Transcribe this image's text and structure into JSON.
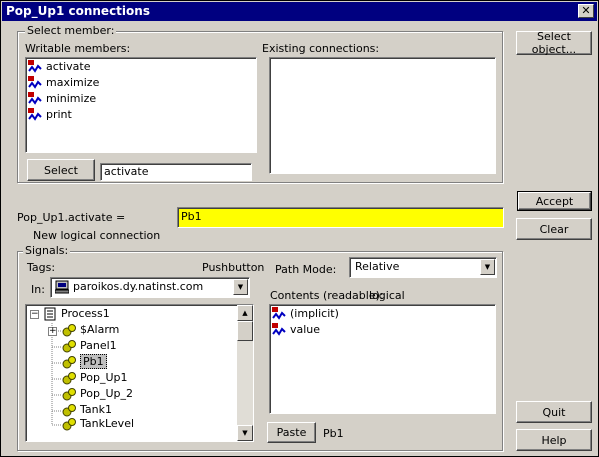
{
  "window": {
    "title": "Pop_Up1 connections",
    "close_label": "✕"
  },
  "select_member": {
    "legend": "Select member:",
    "writable_label": "Writable members:",
    "existing_label": "Existing connections:",
    "members": [
      "activate",
      "maximize",
      "minimize",
      "print"
    ],
    "select_button": "Select",
    "select_value": "activate"
  },
  "buttons": {
    "select_object": "Select object...",
    "accept": "Accept",
    "clear": "Clear",
    "quit": "Quit",
    "help": "Help",
    "paste": "Paste"
  },
  "connection": {
    "label": "Pop_Up1.activate =",
    "value": "Pb1",
    "status": "New logical connection",
    "highlight_color": "#ffff00"
  },
  "signals": {
    "legend": "Signals:",
    "tags_label": "Tags:",
    "tags_type": "Pushbutton",
    "in_label": "In:",
    "in_value": "paroikos.dy.natinst.com",
    "path_mode_label": "Path Mode:",
    "path_mode_value": "Relative",
    "contents_label": "Contents (readable):",
    "contents_type": "logical",
    "tree": {
      "root": "Process1",
      "items": [
        "$Alarm",
        "Panel1",
        "Pb1",
        "Pop_Up1",
        "Pop_Up_2",
        "Tank1",
        "TankLevel"
      ],
      "selected": "Pb1"
    },
    "contents_items": [
      "(implicit)",
      "value"
    ],
    "paste_value": "Pb1"
  }
}
